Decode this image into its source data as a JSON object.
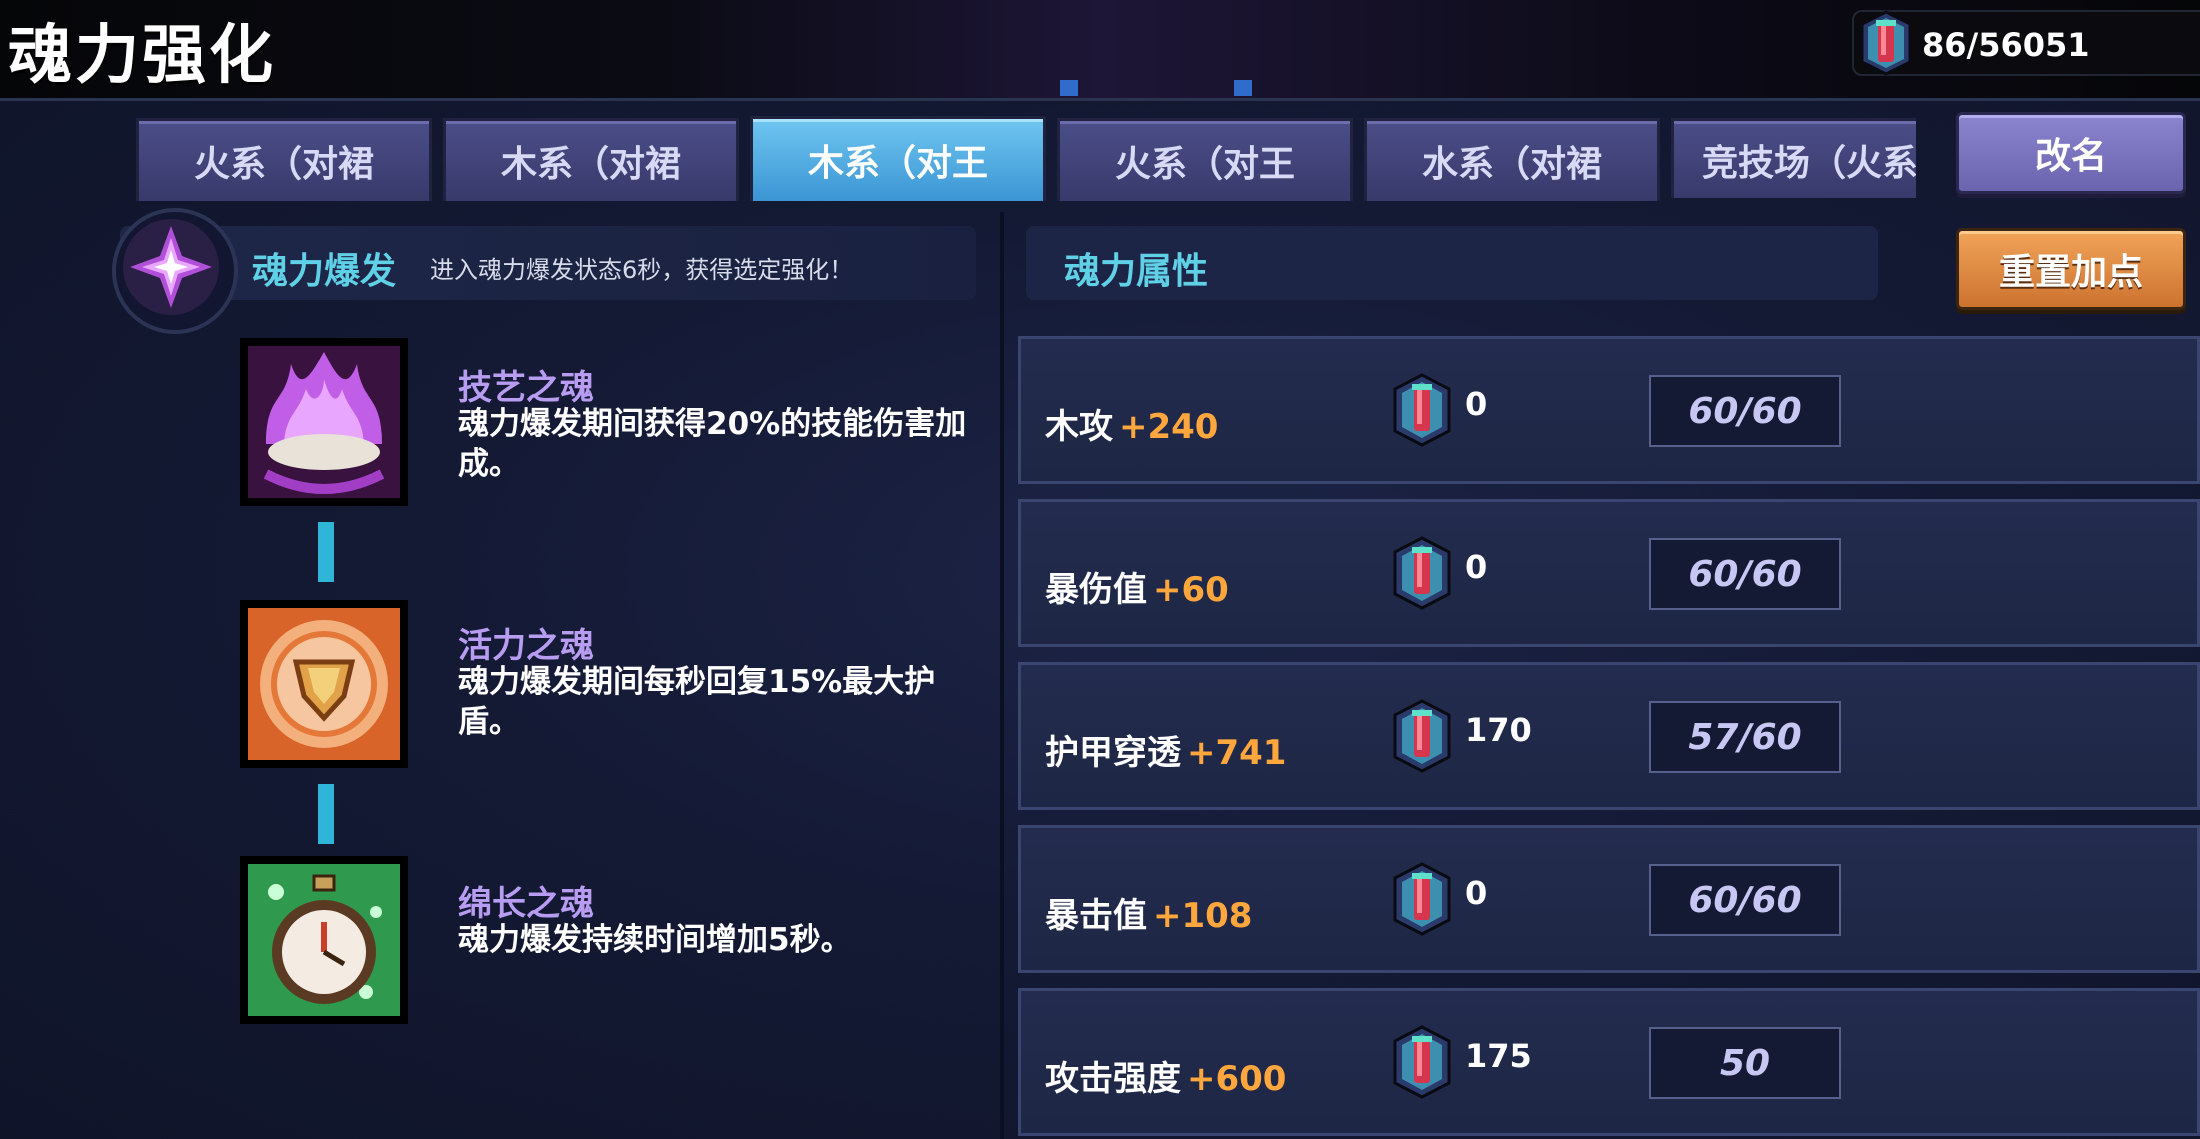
{
  "header": {
    "title": "魂力强化",
    "currency": "86/56051"
  },
  "tabs": [
    {
      "label": "火系（对裙",
      "active": false
    },
    {
      "label": "木系（对裙",
      "active": false
    },
    {
      "label": "木系（对王",
      "active": true
    },
    {
      "label": "火系（对王",
      "active": false
    },
    {
      "label": "水系（对裙",
      "active": false
    },
    {
      "label": "竞技场（火系",
      "active": false
    }
  ],
  "buttons": {
    "rename": "改名",
    "reset": "重置加点"
  },
  "burst": {
    "title": "魂力爆发",
    "desc": "进入魂力爆发状态6秒，获得选定强化！"
  },
  "skills": [
    {
      "name": "技艺之魂",
      "desc": "魂力爆发期间获得20%的技能伤害加成。",
      "icon": "purple-flame-crown-icon"
    },
    {
      "name": "活力之魂",
      "desc": "魂力爆发期间每秒回复15%最大护盾。",
      "icon": "shield-emblem-icon"
    },
    {
      "name": "绵长之魂",
      "desc": "魂力爆发持续时间增加5秒。",
      "icon": "stopwatch-icon"
    }
  ],
  "attributes": {
    "title": "魂力属性",
    "rows": [
      {
        "label": "木攻",
        "bonus": "+240",
        "cost": "0",
        "progress": "60/60"
      },
      {
        "label": "暴伤值",
        "bonus": "+60",
        "cost": "0",
        "progress": "60/60"
      },
      {
        "label": "护甲穿透",
        "bonus": "+741",
        "cost": "170",
        "progress": "57/60"
      },
      {
        "label": "暴击值",
        "bonus": "+108",
        "cost": "0",
        "progress": "60/60"
      },
      {
        "label": "攻击强度",
        "bonus": "+600",
        "cost": "175",
        "progress": "50"
      }
    ]
  },
  "colors": {
    "accent_cyan": "#5fd0e6",
    "bonus_orange": "#ffa63d",
    "skill_name_purple": "#b89cf2",
    "tab_active": "#4aa8e0",
    "reset_orange": "#dc843c"
  }
}
